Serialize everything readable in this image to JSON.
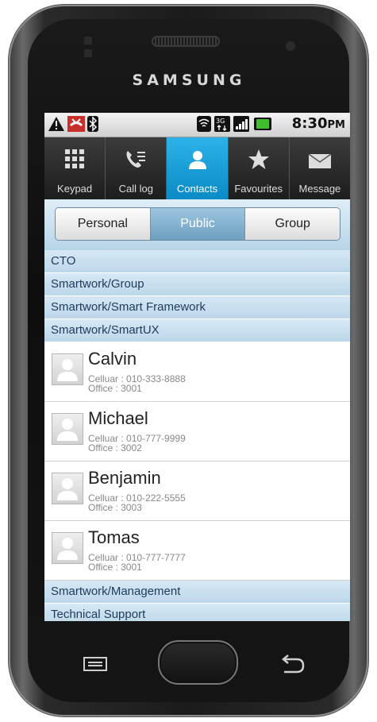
{
  "device": {
    "brand": "SAMSUNG"
  },
  "status_bar": {
    "time": "8:30",
    "ampm": "PM"
  },
  "tabs": [
    {
      "label": "Keypad",
      "icon": "keypad-icon"
    },
    {
      "label": "Call log",
      "icon": "call-log-icon"
    },
    {
      "label": "Contacts",
      "icon": "contact-icon",
      "active": true
    },
    {
      "label": "Favourites",
      "icon": "star-icon"
    },
    {
      "label": "Message",
      "icon": "envelope-icon"
    }
  ],
  "segments": [
    {
      "label": "Personal"
    },
    {
      "label": "Public",
      "selected": true
    },
    {
      "label": "Group"
    }
  ],
  "groups_top": [
    "CTO",
    "Smartwork/Group",
    "Smartwork/Smart Framework",
    "Smartwork/SmartUX"
  ],
  "contacts": [
    {
      "name": "Calvin",
      "cell": "Celluar : 010-333-8888",
      "office": "Office : 3001"
    },
    {
      "name": "Michael",
      "cell": "Celluar : 010-777-9999",
      "office": "Office : 3002"
    },
    {
      "name": "Benjamin",
      "cell": "Celluar : 010-222-5555",
      "office": "Office : 3003"
    },
    {
      "name": "Tomas",
      "cell": "Celluar : 010-777-7777",
      "office": "Office : 3001"
    }
  ],
  "groups_bottom": [
    "Smartwork/Management",
    "Technical Support"
  ],
  "colors": {
    "accent": "#1aa0da",
    "group_bg": "#c9e0ef",
    "group_text": "#1d3b5a"
  }
}
